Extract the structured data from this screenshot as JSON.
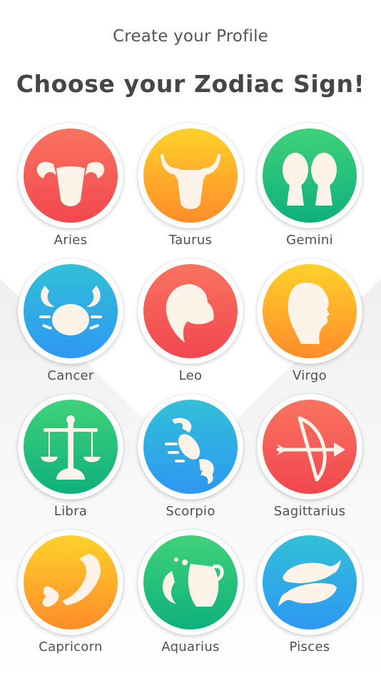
{
  "header": {
    "subtitle": "Create your Profile",
    "title": "Choose your Zodiac Sign!"
  },
  "colors": {
    "red": [
      "#f9735f",
      "#f2474f"
    ],
    "orange": [
      "#ffd12a",
      "#ff8c2a"
    ],
    "green": [
      "#3fd27a",
      "#0eb07c"
    ],
    "blue": [
      "#31c0d8",
      "#2e97f3"
    ],
    "symbol": "#fdf3e8"
  },
  "signs": [
    {
      "label": "Aries",
      "icon": "ram-head-icon",
      "gradient": "red"
    },
    {
      "label": "Taurus",
      "icon": "bull-head-icon",
      "gradient": "orange"
    },
    {
      "label": "Gemini",
      "icon": "twin-heads-icon",
      "gradient": "green"
    },
    {
      "label": "Cancer",
      "icon": "crab-icon",
      "gradient": "blue"
    },
    {
      "label": "Leo",
      "icon": "lion-head-icon",
      "gradient": "red"
    },
    {
      "label": "Virgo",
      "icon": "maiden-profile-icon",
      "gradient": "orange"
    },
    {
      "label": "Libra",
      "icon": "scales-icon",
      "gradient": "green"
    },
    {
      "label": "Scorpio",
      "icon": "scorpion-icon",
      "gradient": "blue"
    },
    {
      "label": "Sagittarius",
      "icon": "bow-and-arrow-icon",
      "gradient": "red"
    },
    {
      "label": "Capricorn",
      "icon": "sea-goat-icon",
      "gradient": "orange"
    },
    {
      "label": "Aquarius",
      "icon": "water-jug-icon",
      "gradient": "green"
    },
    {
      "label": "Pisces",
      "icon": "two-fish-icon",
      "gradient": "blue"
    }
  ]
}
